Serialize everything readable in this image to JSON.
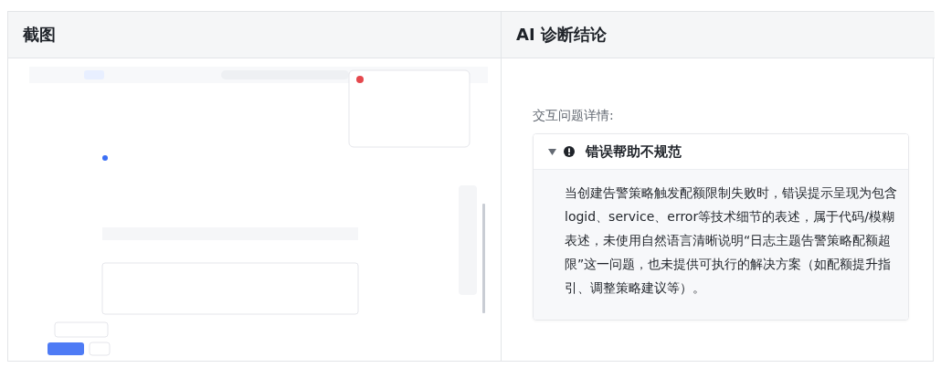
{
  "table": {
    "columns": [
      "截图",
      "AI 诊断结论"
    ],
    "diagnosis": {
      "label": "交互问题详情:",
      "issues": [
        {
          "title": "错误帮助不规范",
          "expanded": true,
          "body": "当创建告警策略触发配额限制失败时，错误提示呈现为包含logid、service、error等技术细节的表述，属于代码/模糊表述，未使用自然语言清晰说明“日志主题告警策略配额超限”这一问题，也未提供可执行的解决方案（如配额提升指引、调整策略建议等）。"
        }
      ]
    }
  }
}
